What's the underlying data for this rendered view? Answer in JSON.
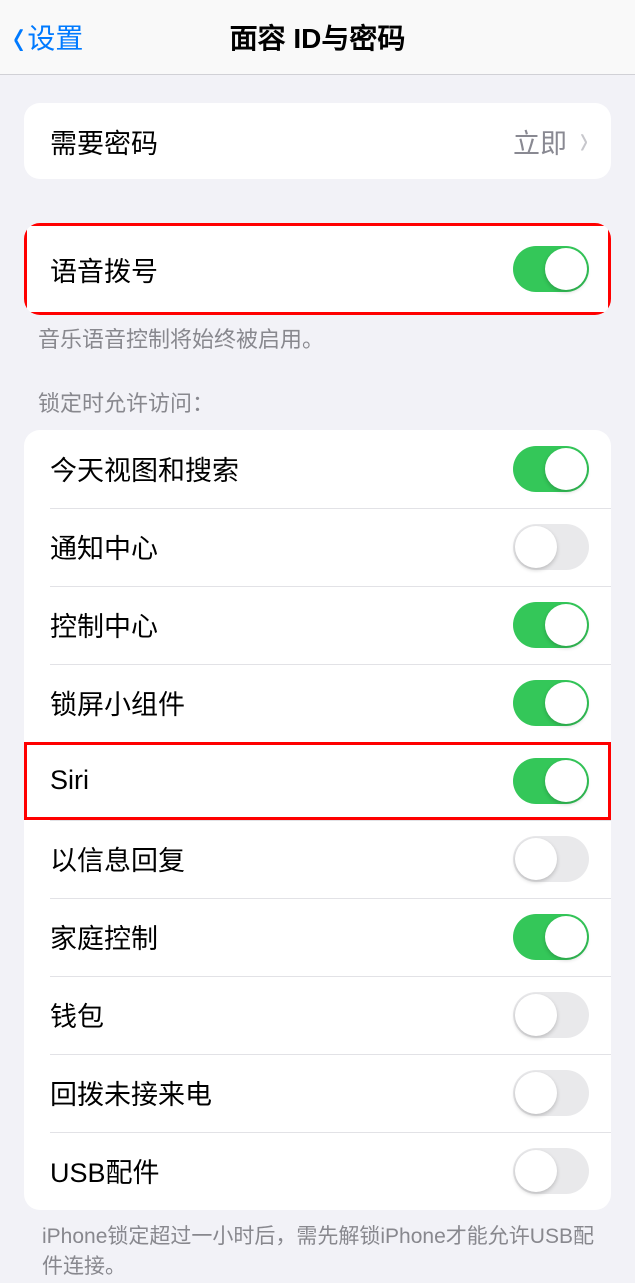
{
  "header": {
    "back_label": "设置",
    "title": "面容 ID与密码"
  },
  "passcode_row": {
    "label": "需要密码",
    "value": "立即"
  },
  "voice_dial": {
    "label": "语音拨号",
    "on": true,
    "hint": "音乐语音控制将始终被启用。"
  },
  "lock_access": {
    "header": "锁定时允许访问：",
    "items": [
      {
        "label": "今天视图和搜索",
        "on": true
      },
      {
        "label": "通知中心",
        "on": false
      },
      {
        "label": "控制中心",
        "on": true
      },
      {
        "label": "锁屏小组件",
        "on": true
      },
      {
        "label": "Siri",
        "on": true
      },
      {
        "label": "以信息回复",
        "on": false
      },
      {
        "label": "家庭控制",
        "on": true
      },
      {
        "label": "钱包",
        "on": false
      },
      {
        "label": "回拨未接来电",
        "on": false
      },
      {
        "label": "USB配件",
        "on": false
      }
    ],
    "footer": "iPhone锁定超过一小时后，需先解锁iPhone才能允许USB配件连接。"
  },
  "highlighted_rows": [
    "语音拨号",
    "Siri"
  ]
}
